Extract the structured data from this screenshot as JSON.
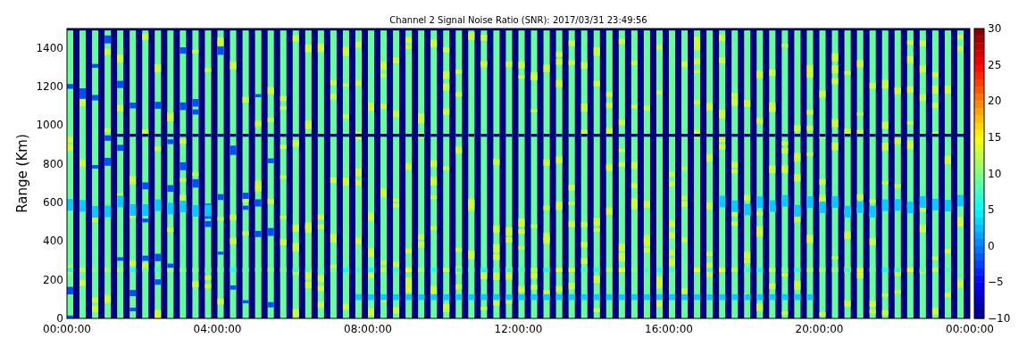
{
  "title": "Channel 2 Signal Noise Ratio (SNR): 2017/03/31 23:49:56",
  "y_axis": {
    "label": "Range (Km)",
    "ticks": [
      "1400",
      "1200",
      "1000",
      "800",
      "600",
      "400",
      "200",
      "0"
    ]
  },
  "x_axis": {
    "ticks": [
      "00:00:00",
      "04:00:00",
      "08:00:00",
      "12:00:00",
      "16:00:00",
      "20:00:00",
      "00:00:00"
    ]
  },
  "colorbar": {
    "ticks": [
      "30",
      "25",
      "20",
      "15",
      "10",
      "5",
      "0",
      "−5",
      "−10"
    ]
  }
}
